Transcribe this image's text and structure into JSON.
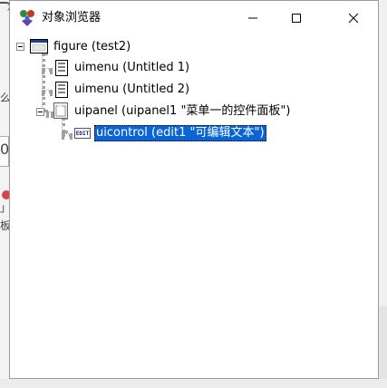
{
  "window": {
    "title": "对象浏览器",
    "controls": {
      "minimize": "minimize-icon",
      "maximize": "maximize-icon",
      "close": "close-icon"
    }
  },
  "background": {
    "fragments": [
      "么",
      "0",
      "」",
      "板"
    ]
  },
  "tree": {
    "nodes": [
      {
        "label": "figure (test2)",
        "icon": "figure-window-icon",
        "level": 0,
        "expanded": true
      },
      {
        "label": "uimenu (Untitled 1)",
        "icon": "uimenu-icon",
        "level": 1
      },
      {
        "label": "uimenu (Untitled 2)",
        "icon": "uimenu-icon",
        "level": 1
      },
      {
        "label": "uipanel (uipanel1 \"菜单一的控件面板\")",
        "icon": "uipanel-icon",
        "level": 1,
        "expanded": true
      },
      {
        "label": "uicontrol (edit1 \"可编辑文本\")",
        "icon": "edit-control-icon",
        "icon_text": "EDIT",
        "level": 2,
        "selected": true
      }
    ]
  },
  "colors": {
    "selection": "#0a64d6",
    "tree_lines": "#a0a0a0"
  }
}
